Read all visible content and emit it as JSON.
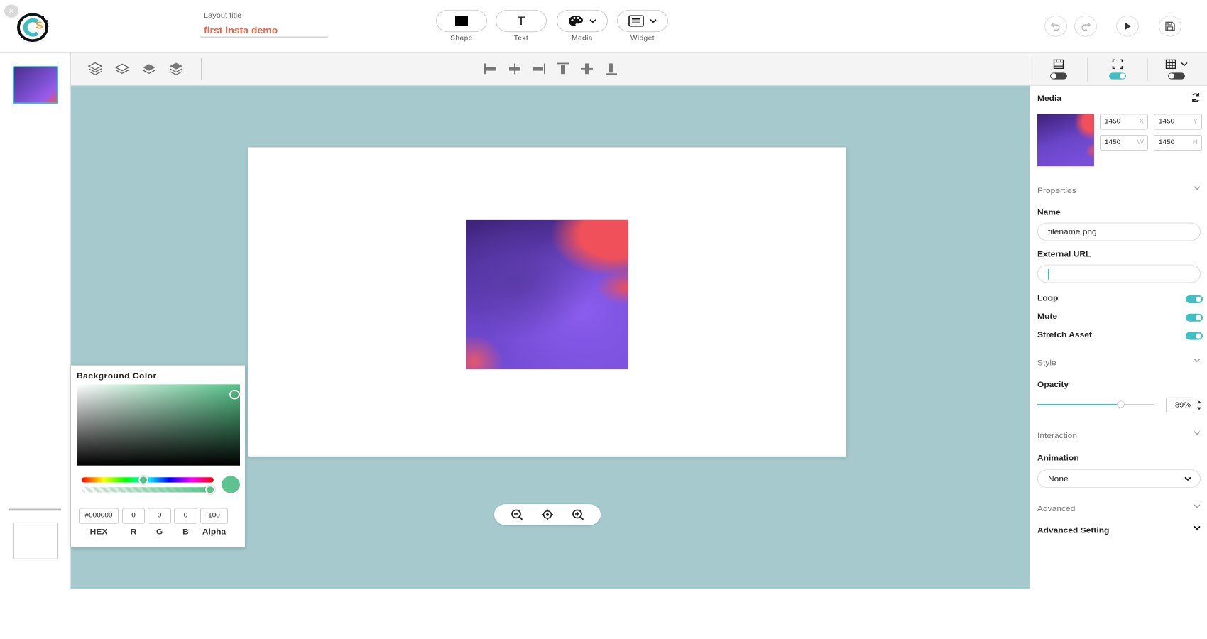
{
  "header": {
    "layout_title_label": "Layout title",
    "layout_title_value": "first insta demo",
    "tools": [
      {
        "label": "Shape",
        "icon": "square-icon"
      },
      {
        "label": "Text",
        "icon": "text-icon",
        "glyph": "T"
      },
      {
        "label": "Media",
        "icon": "palette-icon"
      },
      {
        "label": "Widget",
        "icon": "widget-icon"
      }
    ]
  },
  "picker": {
    "title": "Background Color",
    "hex": "#000000",
    "r": "0",
    "g": "0",
    "b": "0",
    "alpha": "100",
    "labels": {
      "hex": "HEX",
      "r": "R",
      "g": "G",
      "b": "B",
      "alpha": "Alpha"
    },
    "color": "#5cc28f"
  },
  "panel": {
    "title": "Media",
    "x": "1450",
    "x_label": "X",
    "y": "1450",
    "y_label": "Y",
    "w": "1450",
    "w_label": "W",
    "h": "1450",
    "h_label": "H",
    "properties_label": "Properties",
    "name_label": "Name",
    "name_value": "filename.png",
    "external_url_label": "External URL",
    "external_url_value": "",
    "loop_label": "Loop",
    "mute_label": "Mute",
    "stretch_label": "Stretch Asset",
    "style_label": "Style",
    "opacity_label": "Opacity",
    "opacity_value": "89%",
    "opacity_fraction": 0.89,
    "interaction_label": "Interaction",
    "animation_label": "Animation",
    "animation_value": "None",
    "advanced_label": "Advanced",
    "advanced_setting_label": "Advanced Setting"
  },
  "colors": {
    "accent": "#3fbfc4",
    "title_orange": "#e8684a",
    "canvas_bg": "#a5c9cc"
  }
}
